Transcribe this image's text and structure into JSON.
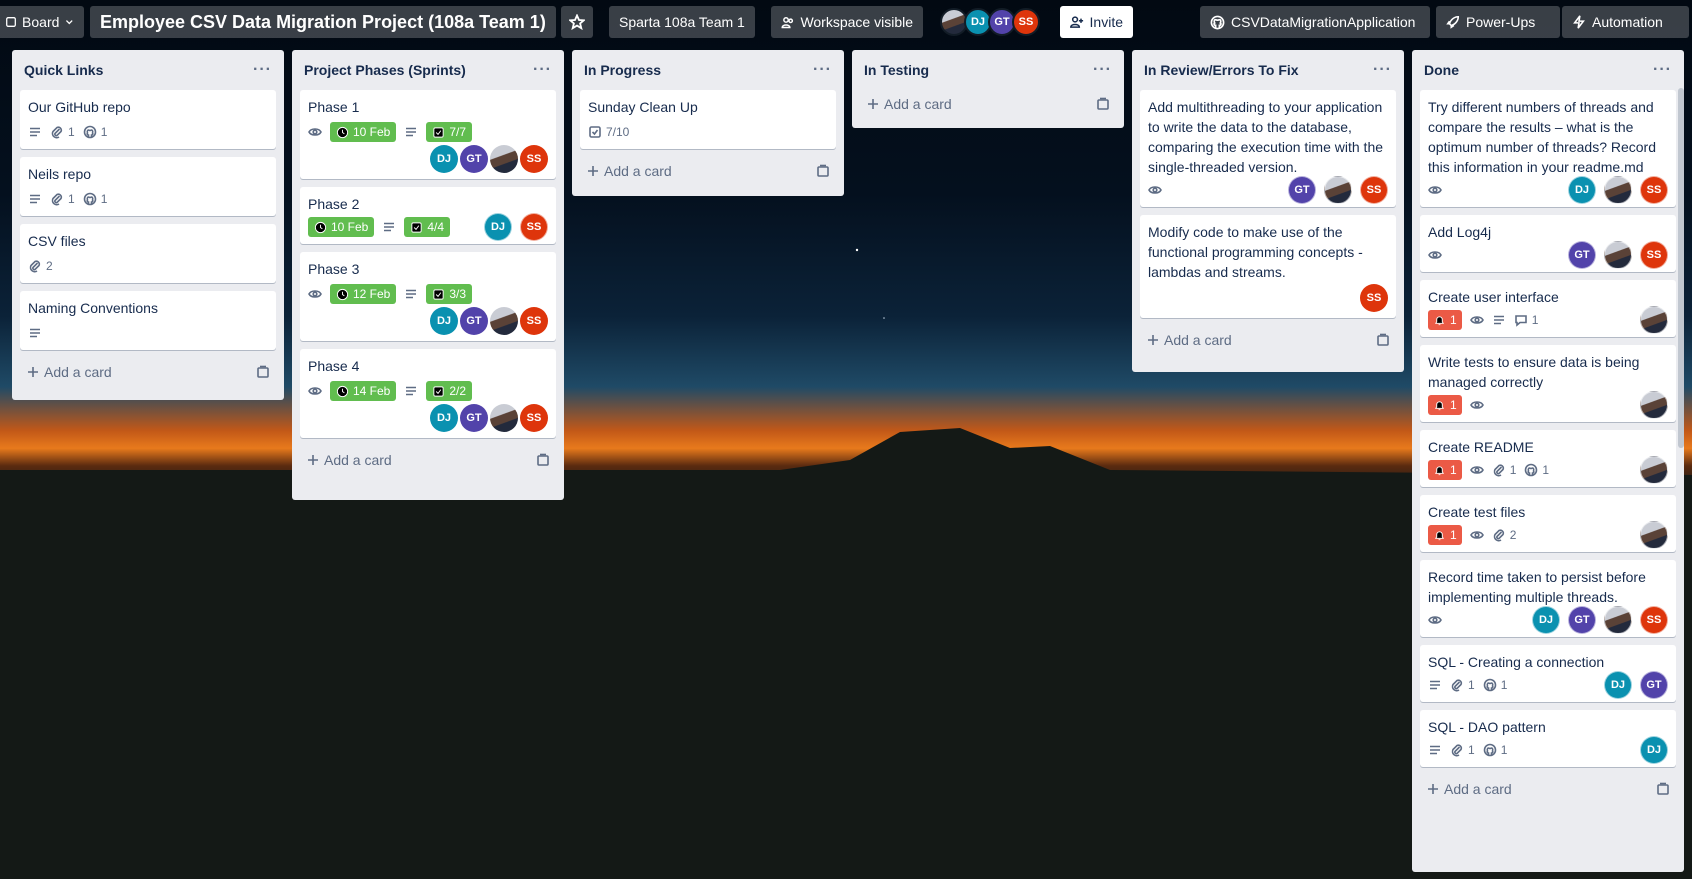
{
  "header": {
    "board_view": "Board",
    "title": "Employee CSV Data Migration Project (108a Team 1)",
    "workspace": "Sparta 108a Team 1",
    "visibility": "Workspace visible",
    "members": [
      "",
      "DJ",
      "GT",
      "SS"
    ],
    "invite": "Invite",
    "github": "CSVDataMigrationApplication",
    "powerups": "Power-Ups",
    "automation": "Automation"
  },
  "add_card_label": "Add a card",
  "lists": [
    {
      "title": "Quick Links",
      "cards": [
        {
          "title": "Our GitHub repo",
          "attachments": "1",
          "github": "1"
        },
        {
          "title": "Neils repo",
          "attachments": "1",
          "github": "1"
        },
        {
          "title": "CSV files",
          "attachments": "2"
        },
        {
          "title": "Naming Conventions"
        }
      ]
    },
    {
      "title": "Project Phases (Sprints)",
      "cards": [
        {
          "title": "Phase 1",
          "due": "10 Feb",
          "checklist": "7/7",
          "members": [
            "DJ",
            "GT",
            "",
            "SS"
          ]
        },
        {
          "title": "Phase 2",
          "due": "10 Feb",
          "checklist": "4/4",
          "members": [
            "DJ",
            "SS"
          ]
        },
        {
          "title": "Phase 3",
          "due": "12 Feb",
          "checklist": "3/3",
          "members": [
            "DJ",
            "GT",
            "",
            "SS"
          ]
        },
        {
          "title": "Phase 4",
          "due": "14 Feb",
          "checklist": "2/2",
          "members": [
            "DJ",
            "GT",
            "",
            "SS"
          ]
        }
      ]
    },
    {
      "title": "In Progress",
      "cards": [
        {
          "title": "Sunday Clean Up",
          "checklist": "7/10"
        }
      ]
    },
    {
      "title": "In Testing",
      "cards": []
    },
    {
      "title": "In Review/Errors To Fix",
      "cards": [
        {
          "title": "Add multithreading to your application to write the data to the database, comparing the execution time with the single-threaded version.",
          "members": [
            "GT",
            "",
            "SS"
          ]
        },
        {
          "title": "Modify code to make use of the functional programming concepts - lambdas and streams.",
          "members": [
            "SS"
          ]
        }
      ]
    },
    {
      "title": "Done",
      "cards": [
        {
          "title": "Try different numbers of threads and compare the results – what is the optimum number of threads? Record this information in your readme.md",
          "members": [
            "DJ",
            "",
            "SS"
          ]
        },
        {
          "title": "Add Log4j",
          "members": [
            "GT",
            "",
            "SS"
          ]
        },
        {
          "title": "Create user interface",
          "notifications": "1",
          "comments": "1",
          "members": [
            ""
          ]
        },
        {
          "title": "Write tests to ensure data is being managed correctly",
          "notifications": "1",
          "members": [
            ""
          ]
        },
        {
          "title": "Create README",
          "notifications": "1",
          "attachments": "1",
          "github": "1",
          "members": [
            ""
          ]
        },
        {
          "title": "Create test files",
          "notifications": "1",
          "attachments": "2",
          "members": [
            ""
          ]
        },
        {
          "title": "Record time taken to persist before implementing multiple threads.",
          "members": [
            "DJ",
            "GT",
            "",
            "SS"
          ]
        },
        {
          "title": "SQL - Creating a connection",
          "attachments": "1",
          "github": "1",
          "members": [
            "DJ",
            "GT"
          ]
        },
        {
          "title": "SQL - DAO pattern",
          "attachments": "1",
          "github": "1",
          "members": [
            "DJ"
          ]
        }
      ]
    }
  ]
}
